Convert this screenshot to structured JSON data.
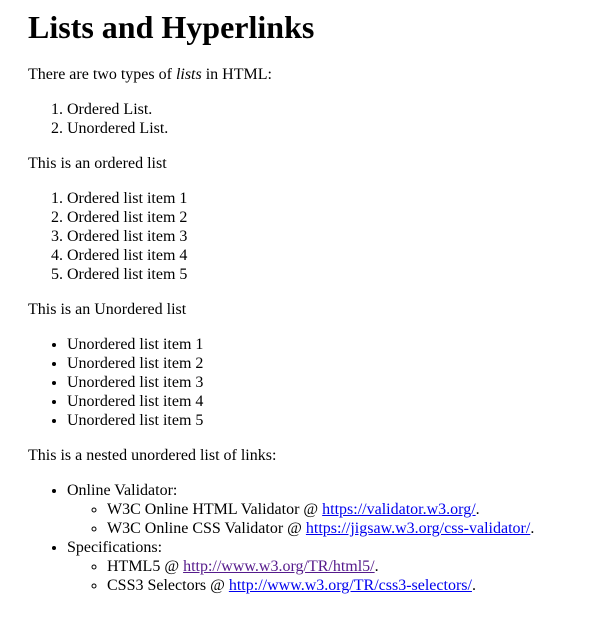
{
  "title": "Lists and Hyperlinks",
  "intro": {
    "before": "There are two types of ",
    "emphasis": "lists",
    "after": " in HTML:"
  },
  "list_types": [
    "Ordered List.",
    "Unordered List."
  ],
  "ordered_heading": "This is an ordered list",
  "ordered_items": [
    "Ordered list item 1",
    "Ordered list item 2",
    "Ordered list item 3",
    "Ordered list item 4",
    "Ordered list item 5"
  ],
  "unordered_heading": "This is an Unordered list",
  "unordered_items": [
    "Unordered list item 1",
    "Unordered list item 2",
    "Unordered list item 3",
    "Unordered list item 4",
    "Unordered list item 5"
  ],
  "nested_heading": "This is a nested unordered list of links:",
  "nested": [
    {
      "label": "Online Validator:",
      "links": [
        {
          "prefix": "W3C Online HTML Validator @ ",
          "url": "https://validator.w3.org/",
          "suffix": "."
        },
        {
          "prefix": "W3C Online CSS Validator @ ",
          "url": "https://jigsaw.w3.org/css-validator/",
          "suffix": "."
        }
      ]
    },
    {
      "label": "Specifications:",
      "links": [
        {
          "prefix": "HTML5 @ ",
          "url": "http://www.w3.org/TR/html5/",
          "suffix": "."
        },
        {
          "prefix": "CSS3 Selectors @ ",
          "url": "http://www.w3.org/TR/css3-selectors/",
          "suffix": "."
        }
      ]
    }
  ],
  "link_colors": {
    "unvisited": "#0000ee",
    "visited": "#551a8b"
  }
}
